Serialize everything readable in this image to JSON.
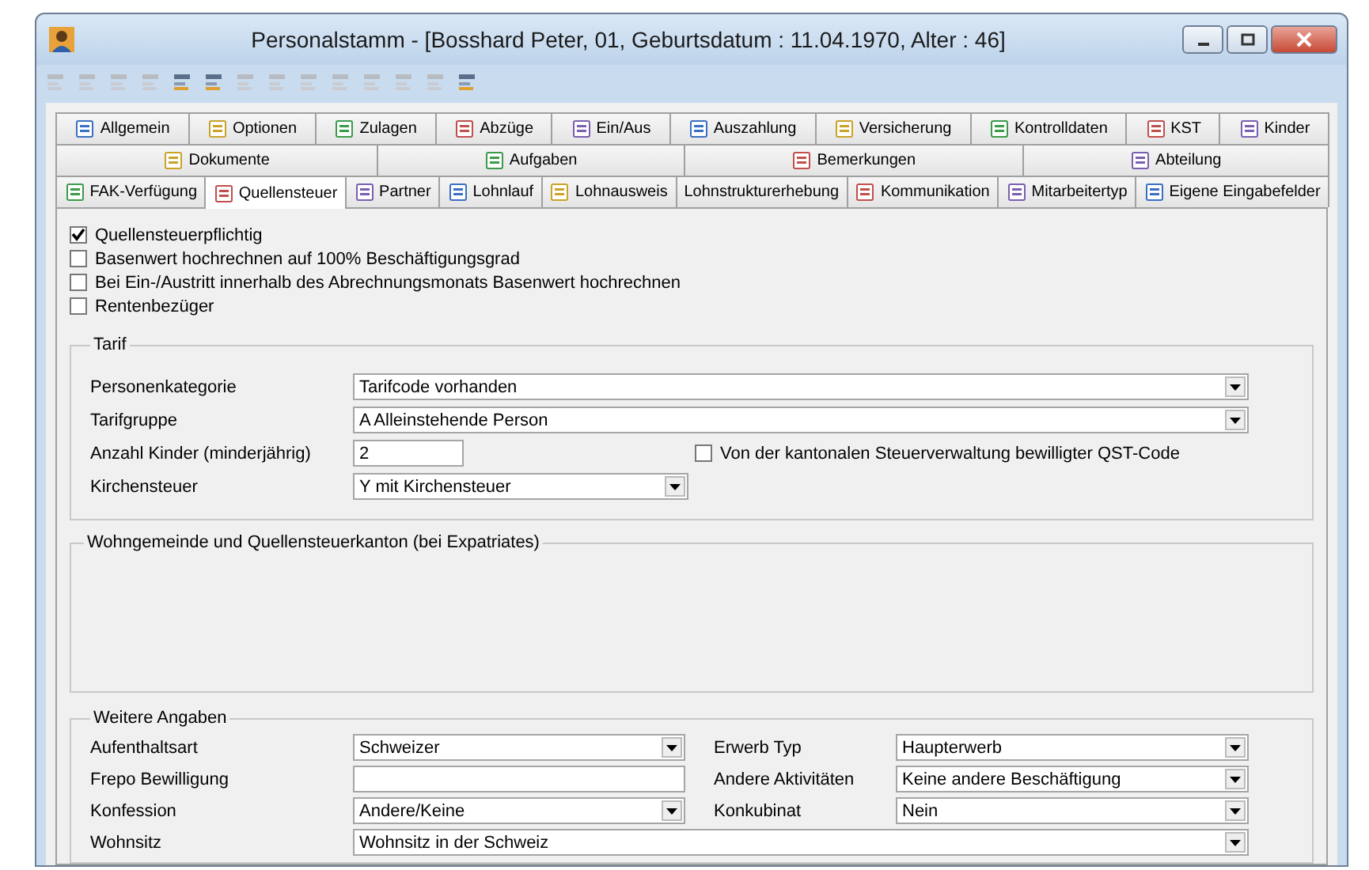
{
  "window": {
    "title": "Personalstamm - [Bosshard Peter, 01, Geburtsdatum : 11.04.1970, Alter : 46]"
  },
  "toolbar": [
    {
      "disabled": true
    },
    {
      "disabled": true
    },
    {
      "disabled": true
    },
    {
      "disabled": true
    },
    {
      "disabled": false
    },
    {
      "disabled": false
    },
    {
      "disabled": true
    },
    {
      "disabled": true
    },
    {
      "disabled": true
    },
    {
      "disabled": true
    },
    {
      "disabled": true
    },
    {
      "disabled": true
    },
    {
      "disabled": true
    },
    {
      "disabled": false
    }
  ],
  "tab_rows": [
    [
      {
        "label": "Allgemein",
        "selected": false,
        "icon": true
      },
      {
        "label": "Optionen",
        "selected": false,
        "icon": true
      },
      {
        "label": "Zulagen",
        "selected": false,
        "icon": true
      },
      {
        "label": "Abzüge",
        "selected": false,
        "icon": true
      },
      {
        "label": "Ein/Aus",
        "selected": false,
        "icon": true
      },
      {
        "label": "Auszahlung",
        "selected": false,
        "icon": true
      },
      {
        "label": "Versicherung",
        "selected": false,
        "icon": true
      },
      {
        "label": "Kontrolldaten",
        "selected": false,
        "icon": true
      },
      {
        "label": "KST",
        "selected": false,
        "icon": true
      },
      {
        "label": "Kinder",
        "selected": false,
        "icon": true
      }
    ],
    [
      {
        "label": "Dokumente",
        "selected": false,
        "icon": true
      },
      {
        "label": "Aufgaben",
        "selected": false,
        "icon": true
      },
      {
        "label": "Bemerkungen",
        "selected": false,
        "icon": true
      },
      {
        "label": "Abteilung",
        "selected": false,
        "icon": true
      }
    ],
    [
      {
        "label": "FAK-Verfügung",
        "selected": false,
        "icon": true
      },
      {
        "label": "Quellensteuer",
        "selected": true,
        "icon": true
      },
      {
        "label": "Partner",
        "selected": false,
        "icon": true
      },
      {
        "label": "Lohnlauf",
        "selected": false,
        "icon": true
      },
      {
        "label": "Lohnausweis",
        "selected": false,
        "icon": true
      },
      {
        "label": "Lohnstrukturerhebung",
        "selected": false,
        "icon": false
      },
      {
        "label": "Kommunikation",
        "selected": false,
        "icon": true
      },
      {
        "label": "Mitarbeitertyp",
        "selected": false,
        "icon": true
      },
      {
        "label": "Eigene Eingabefelder",
        "selected": false,
        "icon": true
      }
    ]
  ],
  "options": [
    {
      "label": "Quellensteuerpflichtig",
      "checked": true
    },
    {
      "label": "Basenwert hochrechnen auf 100% Beschäftigungsgrad",
      "checked": false
    },
    {
      "label": "Bei Ein-/Austritt innerhalb des Abrechnungsmonats Basenwert hochrechnen",
      "checked": false
    },
    {
      "label": "Rentenbezüger",
      "checked": false
    }
  ],
  "tarif": {
    "title": "Tarif",
    "fields": [
      {
        "label": "Personenkategorie",
        "kind": "select",
        "value": "Tarifcode vorhanden"
      },
      {
        "label": "Tarifgruppe",
        "kind": "select",
        "value": "A Alleinstehende Person"
      },
      {
        "label": "Anzahl Kinder (minderjährig)",
        "kind": "input",
        "value": "2"
      },
      {
        "label": "Kirchensteuer",
        "kind": "select",
        "value": "Y mit Kirchensteuer"
      }
    ],
    "extra_check": {
      "label": "Von der kantonalen Steuerverwaltung bewilligter QST-Code",
      "checked": false
    }
  },
  "wohngemeinde": {
    "title": "Wohngemeinde und Quellensteuerkanton (bei Expatriates)"
  },
  "weitere": {
    "title": "Weitere Angaben",
    "fields": [
      {
        "label": "Aufenthaltsart",
        "kind": "select",
        "value": "Schweizer"
      },
      {
        "label": "Erwerb Typ",
        "kind": "select",
        "value": "Haupterwerb"
      },
      {
        "label": "Frepo Bewilligung",
        "kind": "input"
      },
      {
        "label": "Andere Aktivitäten",
        "kind": "select",
        "value": "Keine andere Beschäftigung"
      },
      {
        "label": "Konfession",
        "kind": "select",
        "value": "Andere/Keine"
      },
      {
        "label": "Konkubinat",
        "kind": "select",
        "value": "Nein"
      }
    ],
    "last": {
      "label": "Wohnsitz",
      "kind": "select",
      "value": "Wohnsitz in der Schweiz"
    }
  }
}
